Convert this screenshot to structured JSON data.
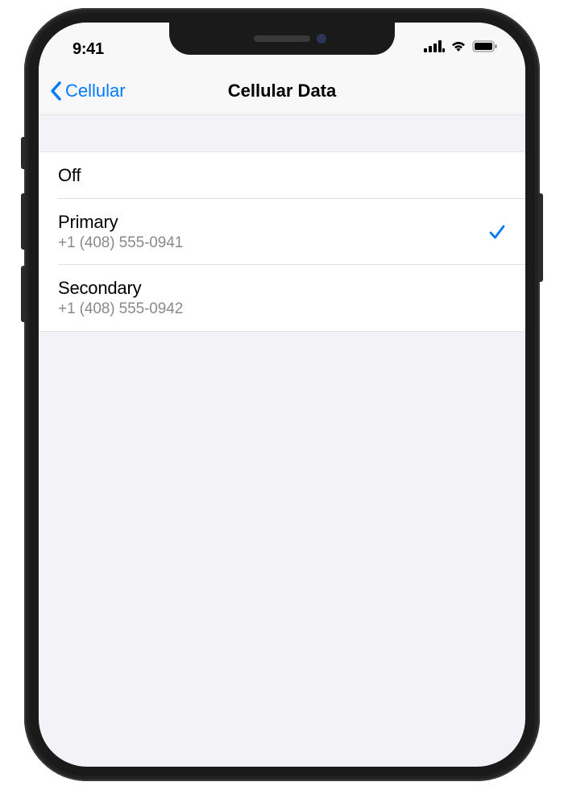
{
  "statusBar": {
    "time": "9:41"
  },
  "navBar": {
    "backLabel": "Cellular",
    "title": "Cellular Data"
  },
  "options": [
    {
      "label": "Off",
      "detail": "",
      "selected": false
    },
    {
      "label": "Primary",
      "detail": "+1 (408) 555-0941",
      "selected": true
    },
    {
      "label": "Secondary",
      "detail": "+1 (408) 555-0942",
      "selected": false
    }
  ]
}
